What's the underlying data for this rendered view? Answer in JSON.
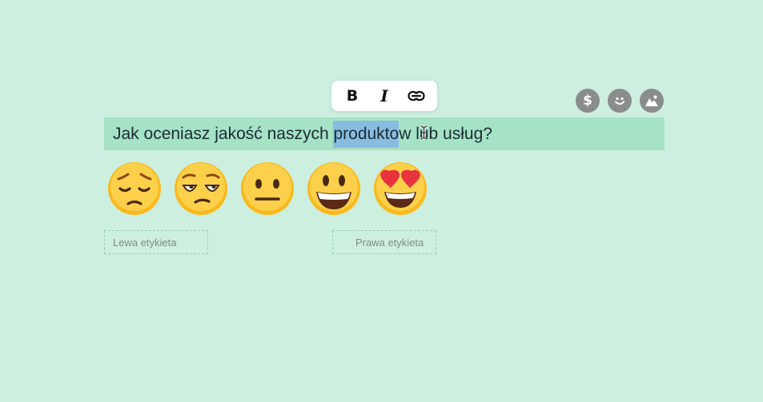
{
  "toolbar": {
    "bold_label": "B",
    "italic_label": "I",
    "link_icon": "link-icon"
  },
  "question_tools": {
    "currency_symbol": "$",
    "icons": [
      "dollar-icon",
      "smiley-icon",
      "image-icon"
    ],
    "button_color": "#8a8c8e"
  },
  "question": {
    "text_before": "Jak oceniasz jakość naszych ",
    "text_selected": "produkto",
    "text_after": "w lub usług?"
  },
  "rating": {
    "options": [
      {
        "icon": "pensive-face-icon"
      },
      {
        "icon": "unamused-face-icon"
      },
      {
        "icon": "neutral-face-icon"
      },
      {
        "icon": "grinning-face-icon"
      },
      {
        "icon": "heart-eyes-face-icon"
      }
    ]
  },
  "labels": {
    "left_placeholder": "Lewa etykieta",
    "right_placeholder": "Prawa etykieta"
  },
  "colors": {
    "background": "#cdefdf",
    "question_bar": "#a5e2c6",
    "selection": "#88bde0",
    "text": "#1c2b33",
    "emoji_yellow": "#f9b91e"
  }
}
